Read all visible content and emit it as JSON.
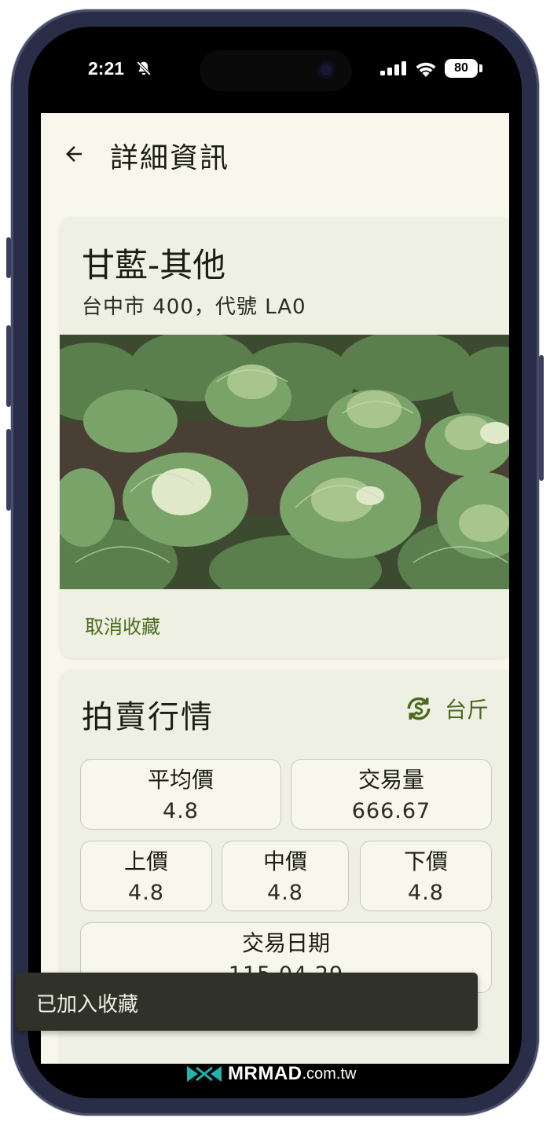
{
  "status_bar": {
    "time": "2:21",
    "battery": "80",
    "bell_icon": "bell-slash-icon",
    "signal_icon": "cellular-signal-icon",
    "wifi_icon": "wifi-icon"
  },
  "header": {
    "back_icon": "arrow-left-icon",
    "title": "詳細資訊"
  },
  "product": {
    "name": "甘藍-其他",
    "subtitle": "台中市 400，代號 LA0",
    "photo": "cabbage-field-photo",
    "unfavorite_label": "取消收藏"
  },
  "market": {
    "title": "拍賣行情",
    "unit_icon": "currency-exchange-icon",
    "unit_label": "台斤",
    "stats": {
      "avg_price": {
        "label": "平均價",
        "value": "4.8"
      },
      "volume": {
        "label": "交易量",
        "value": "666.67"
      },
      "upper_price": {
        "label": "上價",
        "value": "4.8"
      },
      "mid_price": {
        "label": "中價",
        "value": "4.8"
      },
      "lower_price": {
        "label": "下價",
        "value": "4.8"
      },
      "trade_date": {
        "label": "交易日期",
        "value": "115.04.29"
      }
    }
  },
  "snackbar": {
    "message": "已加入收藏"
  },
  "watermark": {
    "brand": "MRMAD",
    "domain": ".com.tw",
    "logo_icon": "mrmad-logo-icon"
  },
  "colors": {
    "background": "#f7f7ec",
    "card": "#eff0e4",
    "accent": "#4b6a1f",
    "snackbar": "#303128",
    "frame": "#2a2d47",
    "watermark_logo": "#1fb5ac"
  }
}
